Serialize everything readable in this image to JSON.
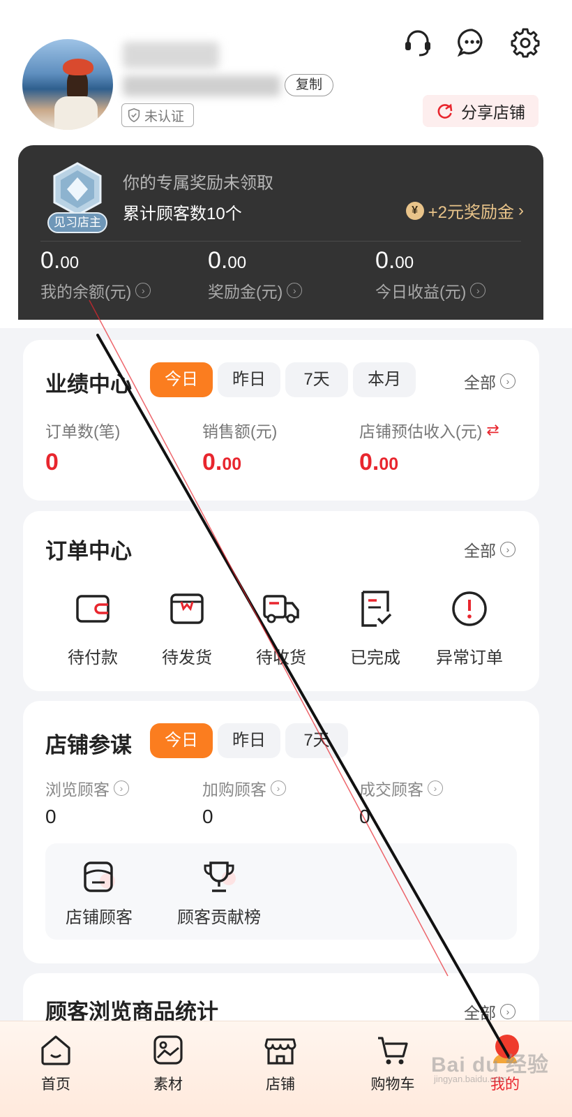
{
  "profile": {
    "copy_label": "复制",
    "verify_label": "未认证",
    "share_label": "分享店铺"
  },
  "header_icons": [
    "headset-icon",
    "chat-bubble-icon",
    "settings-gear-icon"
  ],
  "reward": {
    "medal_label": "见习店主",
    "subtitle": "你的专属奖励未领取",
    "count_text": "累计顾客数10个",
    "bonus_text": "+2元奖励金",
    "bonus_arrow": "›",
    "yen": "¥",
    "balances": [
      {
        "int": "0.",
        "dec": "00",
        "label": "我的余额(元)"
      },
      {
        "int": "0.",
        "dec": "00",
        "label": "奖励金(元)"
      },
      {
        "int": "0.",
        "dec": "00",
        "label": "今日收益(元)"
      }
    ]
  },
  "performance": {
    "title": "业绩中心",
    "tabs": [
      "今日",
      "昨日",
      "7天",
      "本月"
    ],
    "active_tab": "今日",
    "see_all": "全部",
    "metrics": [
      {
        "label": "订单数(笔)",
        "int": "0",
        "dec": ""
      },
      {
        "label": "销售额(元)",
        "int": "0.",
        "dec": "00"
      },
      {
        "label": "店铺预估收入(元)",
        "int": "0.",
        "dec": "00",
        "swap": "⇄"
      }
    ]
  },
  "orders": {
    "title": "订单中心",
    "see_all": "全部",
    "items": [
      {
        "label": "待付款",
        "icon": "wallet-icon"
      },
      {
        "label": "待发货",
        "icon": "package-icon"
      },
      {
        "label": "待收货",
        "icon": "delivery-truck-icon"
      },
      {
        "label": "已完成",
        "icon": "completed-receipt-icon"
      },
      {
        "label": "异常订单",
        "icon": "alert-circle-icon"
      }
    ]
  },
  "advisor": {
    "title": "店铺参谋",
    "tabs": [
      "今日",
      "昨日",
      "7天"
    ],
    "active_tab": "今日",
    "stats": [
      {
        "label": "浏览顾客",
        "value": "0"
      },
      {
        "label": "加购顾客",
        "value": "0"
      },
      {
        "label": "成交顾客",
        "value": "0"
      }
    ],
    "shortcuts": [
      {
        "label": "店铺顾客",
        "icon": "customers-icon"
      },
      {
        "label": "顾客贡献榜",
        "icon": "trophy-icon"
      }
    ]
  },
  "browse_stats": {
    "title": "顾客浏览商品统计",
    "see_all": "全部"
  },
  "nav": {
    "items": [
      {
        "label": "首页",
        "icon": "home-icon"
      },
      {
        "label": "素材",
        "icon": "image-material-icon"
      },
      {
        "label": "店铺",
        "icon": "store-icon"
      },
      {
        "label": "购物车",
        "icon": "shopping-cart-icon"
      },
      {
        "label": "我的",
        "icon": "profile-icon"
      }
    ],
    "active": "我的"
  },
  "watermark": {
    "text": "Bai du 经验",
    "url": "jingyan.baidu.com"
  },
  "colors": {
    "accent_orange": "#fb7d1f",
    "value_red": "#e8262e",
    "dark_card": "#333333",
    "gold": "#e9c48a"
  }
}
